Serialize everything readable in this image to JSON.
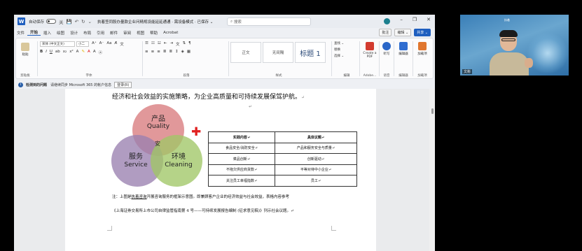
{
  "window": {
    "autosave_label": "自动保存",
    "autosave_state": "关",
    "doc_title": "执着签同股办量款企业问精规设能延延通通 · 需设备模式 · 已保存 ⌄",
    "search_placeholder": "搜索",
    "user_initial": "S",
    "brand_color": "#1f5fbf"
  },
  "tabs": [
    "文件",
    "开始",
    "插入",
    "绘图",
    "设计",
    "布局",
    "引用",
    "邮件",
    "审阅",
    "视图",
    "帮助",
    "Acrobat"
  ],
  "tab_actions": {
    "comments": "批注",
    "edit": "编辑 ⌄",
    "share": "共享 ⌄"
  },
  "ribbon": {
    "paste": "粘贴",
    "clipboard": "剪贴板",
    "font_name": "宋体 (中文正文)",
    "font_size": "小二",
    "font_group": "字体",
    "paragraph_group": "段落",
    "styles": [
      "正文",
      "无间隔",
      "标题 1"
    ],
    "style_group": "样式",
    "find": "查找 ⌄",
    "replace": "替换",
    "select": "选择 ⌄",
    "edit_group": "编辑",
    "acrobat_btn": "Create a PDF",
    "acrobat_group": "Adobe...",
    "dictate": "听写",
    "voice_group": "语音",
    "editor": "编辑器",
    "editor_group": "编辑器",
    "addins": "加载项",
    "addins_group": "加载项"
  },
  "infobar": {
    "title": "检测到的问题",
    "message": "请继续同步 Microsoft 365 的帐户信息",
    "button": "登录(R)"
  },
  "document": {
    "line1": "经济和社会效益的实施策略，为企业高质量和可持续发展保驾护航。",
    "paragraph_mark": "↵",
    "venn": {
      "quality_cn": "产品",
      "quality_en": "Quality",
      "service_cn": "服务",
      "service_en": "Service",
      "cleaning_cn": "环境",
      "cleaning_en": "Cleaning",
      "center": "安"
    },
    "table": {
      "headers": [
        "实践内容↵",
        "具体议题↵"
      ],
      "rows": [
        [
          "食品安全/消防安全↵",
          "产品和服务安全与质量↵"
        ],
        [
          "菜品创新↵",
          "创新驱动↵"
        ],
        [
          "不拖欠供应商货款↵",
          "平等对待中小企业↵"
        ],
        [
          "关注员工幸福指数↵",
          "员工↵"
        ]
      ]
    },
    "note1_prefix": "注：上图是",
    "note1_link": "执着咨询",
    "note1_rest": "开展咨询服务的框架示意图。即兼顾客户企业的经济效益与社会效益，表格内容参考",
    "note2": "《上海证券交易所上市公司自律监管指南第 4 号——可持续发展报告编制 (征求意见稿)》列示社会议题。↵"
  },
  "meeting": {
    "participant_name": "文彬",
    "logo_text": "执着"
  }
}
